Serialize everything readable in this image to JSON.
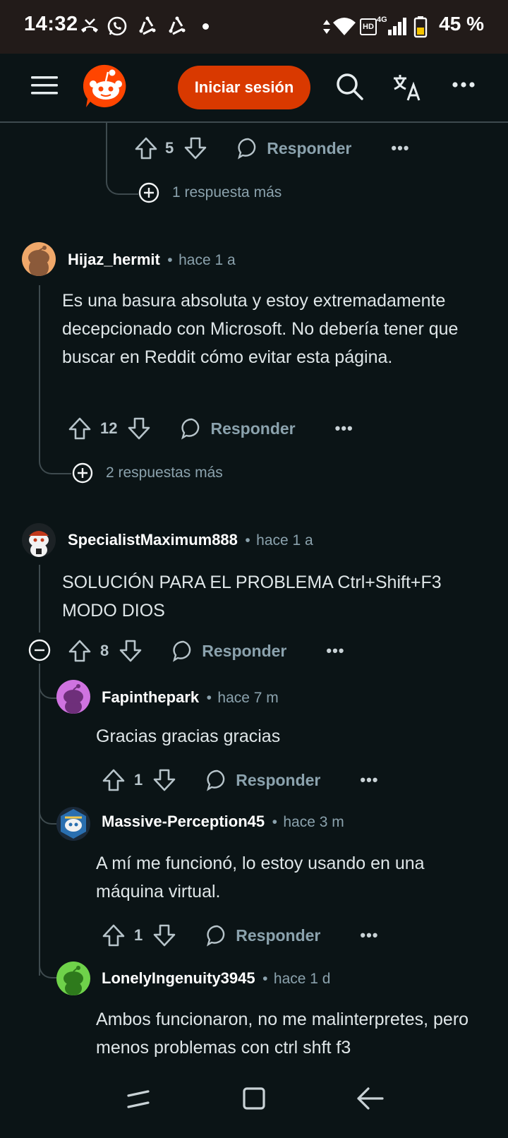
{
  "status_bar": {
    "time": "14:32",
    "battery": "45 %",
    "net_label": "HD",
    "net_gen": "4G"
  },
  "header": {
    "login_label": "Iniciar sesión"
  },
  "top_fragment": {
    "votes": "5",
    "reply_label": "Responder",
    "more_replies": "1 respuesta más"
  },
  "comments": [
    {
      "author": "Hijaz_hermit",
      "time": "hace 1 a",
      "body": "Es una basura absoluta y estoy extremadamente decepcionado con Microsoft. No debería tener que buscar en Reddit cómo evitar esta página.",
      "votes": "12",
      "reply_label": "Responder",
      "more_replies": "2 respuestas más"
    },
    {
      "author": "SpecialistMaximum888",
      "time": "hace 1 a",
      "body": "SOLUCIÓN PARA EL PROBLEMA Ctrl+Shift+F3 MODO DIOS",
      "votes": "8",
      "reply_label": "Responder",
      "replies": [
        {
          "author": "Fapinthepark",
          "time": "hace 7 m",
          "body": "Gracias gracias gracias",
          "votes": "1",
          "reply_label": "Responder"
        },
        {
          "author": "Massive-Perception45",
          "time": "hace 3 m",
          "body": "A mí me funcionó, lo estoy usando en una máquina virtual.",
          "votes": "1",
          "reply_label": "Responder"
        },
        {
          "author": "LonelyIngenuity3945",
          "time": "hace 1 d",
          "body": "Ambos funcionaron, no me malinterpretes, pero menos problemas con ctrl shft f3"
        }
      ]
    }
  ],
  "colors": {
    "background": "#0b1416",
    "accent": "#d93900",
    "meta": "#8ba2ad",
    "thread_line": "#3e4a4e"
  }
}
